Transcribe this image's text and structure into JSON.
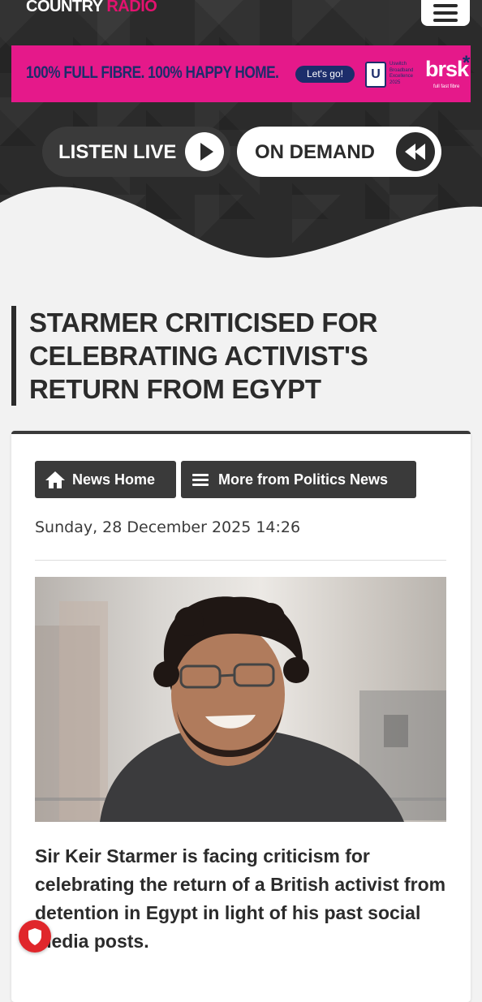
{
  "header": {
    "logo_line1": "COUNTRY",
    "logo_line2": "RADIO",
    "menu_icon": "hamburger-icon"
  },
  "ad_banner": {
    "headline": "100% FULL FIBRE. 100% HAPPY HOME.",
    "cta": "Let's go!",
    "award_mark": "U",
    "award_text": "Uswitch Broadband Excellence 2025",
    "brand": "brsk",
    "brand_star": "*",
    "brand_tagline": "full fast fibre",
    "colors": {
      "background": "#e5198a",
      "navy": "#1c2d6b"
    }
  },
  "player": {
    "listen_live_label": "LISTEN LIVE",
    "listen_live_icon": "play-icon",
    "on_demand_label": "ON DEMAND",
    "on_demand_icon": "rewind-icon"
  },
  "article": {
    "title": "STARMER CRITICISED FOR CELEBRATING ACTIVIST'S RETURN FROM EGYPT",
    "news_home_label": "News Home",
    "news_home_icon": "home-icon",
    "more_label": "More from Politics News",
    "more_icon": "list-icon",
    "date": "Sunday, 28 December 2025 14:26",
    "image_alt": "Smiling man with curly hair and glasses",
    "lede": "Sir Keir Starmer is facing criticism for celebrating the return of a British activist from detention in Egypt in light of his past social media posts."
  },
  "privacy_badge": {
    "icon": "shield-icon",
    "color": "#e0262b"
  },
  "colors": {
    "accent": "#e3126f",
    "dark": "#2b2b2b",
    "page_bg": "#f2f2f2"
  }
}
